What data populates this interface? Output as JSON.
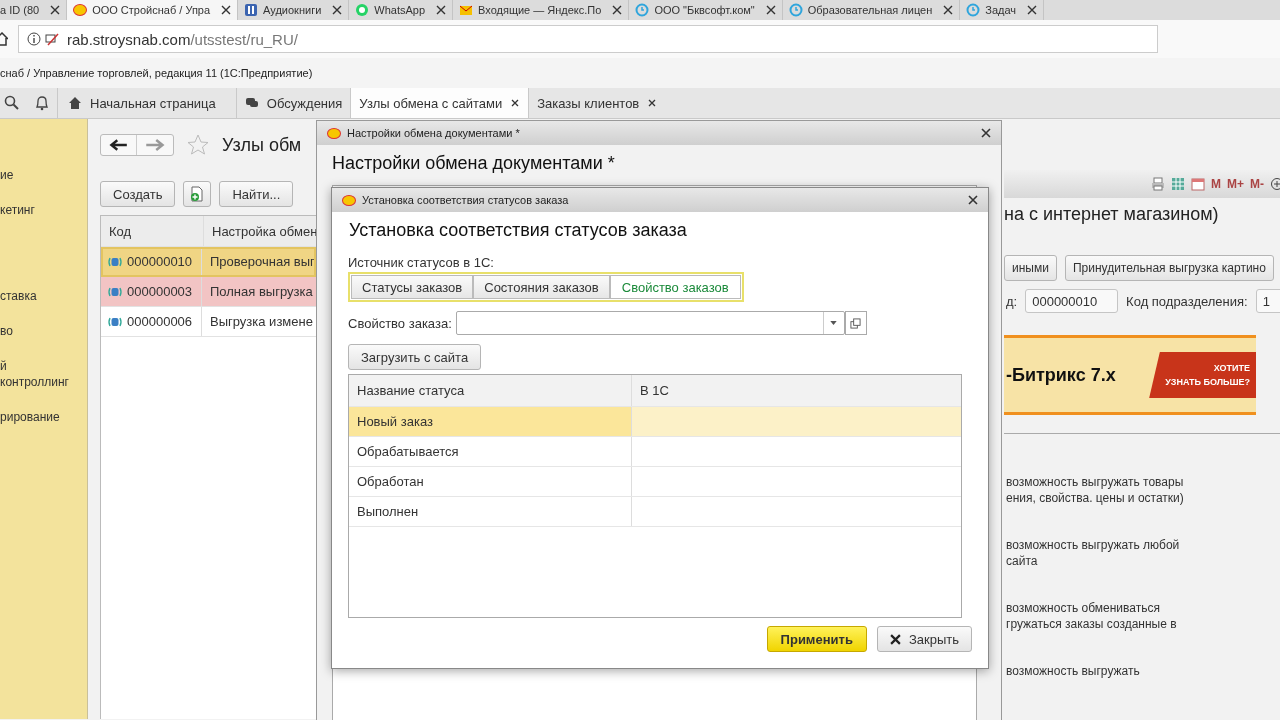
{
  "browser": {
    "tabs": [
      {
        "title": "а ID (80",
        "selected": false,
        "kind": "plain"
      },
      {
        "title": "ООО Стройснаб / Упра",
        "selected": true,
        "kind": "onec"
      },
      {
        "title": "Аудиокниги",
        "selected": false,
        "kind": "book"
      },
      {
        "title": "WhatsApp",
        "selected": false,
        "kind": "chat"
      },
      {
        "title": "Входящие — Яндекс.По",
        "selected": false,
        "kind": "mail"
      },
      {
        "title": "ООО \"Бквсофт.ком\"",
        "selected": false,
        "kind": "clock"
      },
      {
        "title": "Образовательная лицен",
        "selected": false,
        "kind": "clock"
      },
      {
        "title": "Задач",
        "selected": false,
        "kind": "clock"
      }
    ],
    "url_host": "rab.stroysnab.com",
    "url_path": "/utsstest/ru_RU/"
  },
  "app": {
    "title": "снаб / Управление торговлей, редакция 11  (1С:Предприятие)",
    "tabs": [
      {
        "label": "Начальная страница",
        "kind": "home",
        "closable": false,
        "selected": false
      },
      {
        "label": "Обсуждения",
        "kind": "chat",
        "closable": false,
        "selected": false
      },
      {
        "label": "Узлы обмена с сайтами",
        "kind": "plain",
        "closable": true,
        "selected": true
      },
      {
        "label": "Заказы клиентов",
        "kind": "plain",
        "closable": true,
        "selected": false
      }
    ]
  },
  "sidebar": {
    "items": [
      {
        "label": "ие"
      },
      {
        "label": "кетинг"
      },
      {
        "label": "ставка"
      },
      {
        "label": "во"
      },
      {
        "label": "й\nконтроллинг"
      },
      {
        "label": "рирование"
      }
    ]
  },
  "list": {
    "title": "Узлы обм",
    "buttons": [
      "Создать",
      "Найти..."
    ],
    "columns": [
      "Код",
      "Настройка обмен"
    ],
    "rows": [
      {
        "code": "000000010",
        "name": "Проверочная выг",
        "selected": true,
        "highlighted": false
      },
      {
        "code": "000000003",
        "name": "Полная выгрузка",
        "selected": false,
        "highlighted": true
      },
      {
        "code": "000000006",
        "name": "Выгрузка измене",
        "selected": false,
        "highlighted": false
      }
    ]
  },
  "node_form": {
    "toolbar": [
      "M",
      "M+",
      "M-"
    ],
    "title": "на с интернет магазином)",
    "buttons": [
      "иными",
      "Принудительная выгрузка картино"
    ],
    "code_label": "д:",
    "code_value": "000000010",
    "division_label": "Код подразделения:",
    "division_value": "1",
    "banner": {
      "product": "-Битрикс 7.x",
      "cta_line_1": "ХОТИТЕ",
      "cta_line_2": "УЗНАТЬ БОЛЬШЕ?"
    },
    "descriptions": [
      [
        "возможность выгружать товары",
        "ения, свойства. цены и остатки)"
      ],
      [
        "возможность выгружать любой",
        "сайта"
      ],
      [
        "возможность обмениваться",
        "гружаться заказы созданные в"
      ],
      [
        "возможность выгружать"
      ]
    ]
  },
  "outer_dialog": {
    "window_title": "Настройки обмена документами *",
    "heading": "Настройки обмена документами *"
  },
  "inner_dialog": {
    "window_title": "Установка соответствия статусов заказа",
    "heading": "Установка соответствия статусов заказа",
    "source_label": "Источник статусов в 1С:",
    "source_options": [
      {
        "label": "Статусы заказов",
        "selected": false
      },
      {
        "label": "Состояния заказов",
        "selected": false
      },
      {
        "label": "Свойство заказов",
        "selected": true
      }
    ],
    "property_label": "Свойство заказа:",
    "load_button": "Загрузить с сайта",
    "columns": [
      "Название статуса",
      "В 1С"
    ],
    "rows": [
      {
        "status": "Новый заказ",
        "selected": true
      },
      {
        "status": "Обрабатывается",
        "selected": false
      },
      {
        "status": "Обработан",
        "selected": false
      },
      {
        "status": "Выполнен",
        "selected": false
      }
    ],
    "apply_button": "Применить",
    "close_button": "Закрыть"
  }
}
